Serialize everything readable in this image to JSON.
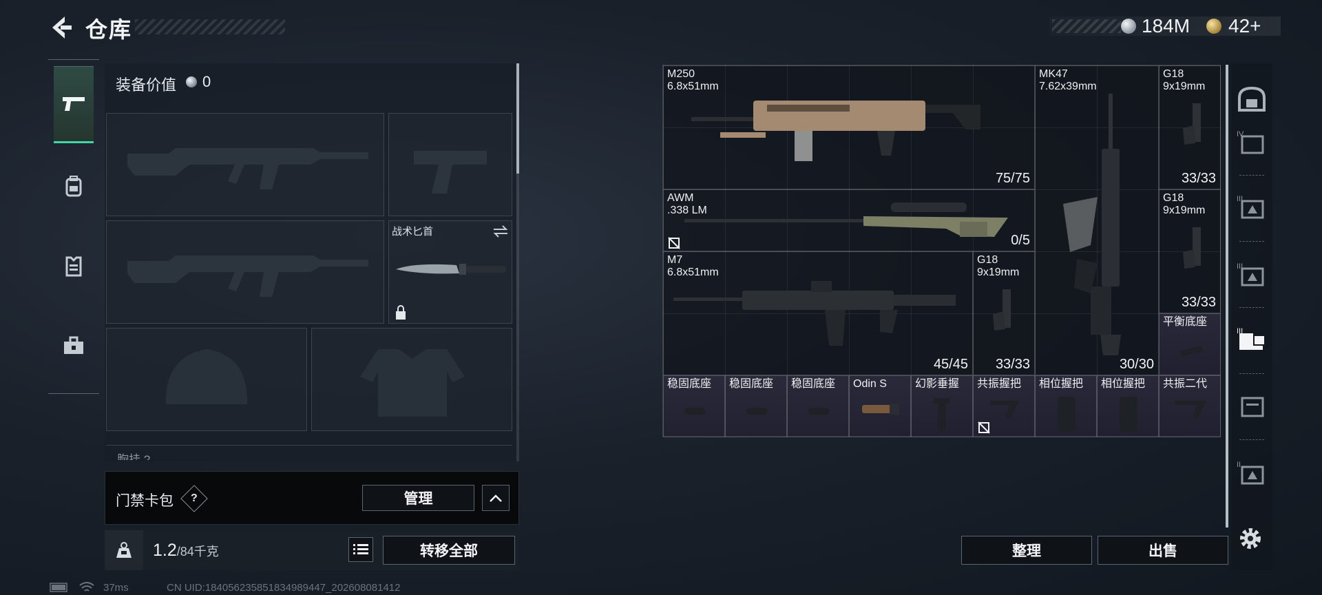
{
  "header": {
    "title": "仓库",
    "currency": [
      {
        "icon": "silver-coin-icon",
        "value": "184M"
      },
      {
        "icon": "gold-coin-icon",
        "value": "42+"
      }
    ]
  },
  "left_nav": {
    "items": [
      "pistol-icon",
      "backpack-icon",
      "vest-icon",
      "toolbox-icon"
    ],
    "active": 0
  },
  "loadout": {
    "equip_value_label": "装备价值",
    "equip_value": "0",
    "knife_slot_label": "战术匕首",
    "chest_label": "胸挂 ?",
    "access_card_label": "门禁卡包",
    "help": "?",
    "manage_button": "管理",
    "weight": "1.2",
    "weight_capacity": "/84千克",
    "transfer_all_button": "转移全部"
  },
  "status": {
    "ping": "37ms",
    "uid": "CN UID:1840562358518349894​47_202608081412"
  },
  "stash_items": [
    {
      "name": "M250",
      "sub": "6.8x51mm",
      "ammo": "75/75",
      "rarity": "normal"
    },
    {
      "name": "MK47",
      "sub": "7.62x39mm",
      "ammo": "30/30",
      "rarity": "normal"
    },
    {
      "name": "G18",
      "sub": "9x19mm",
      "ammo": "33/33",
      "rarity": "normal"
    },
    {
      "name": "AWM",
      "sub": ".338 LM",
      "ammo": "0/5",
      "rarity": "normal"
    },
    {
      "name": "G18",
      "sub": "9x19mm",
      "ammo": "33/33",
      "rarity": "normal"
    },
    {
      "name": "M7",
      "sub": "6.8x51mm",
      "ammo": "45/45",
      "rarity": "normal"
    },
    {
      "name": "G18",
      "sub": "9x19mm",
      "ammo": "33/33",
      "rarity": "normal"
    },
    {
      "name": "平衡底座",
      "rarity": "purple"
    },
    {
      "name": "稳固底座",
      "rarity": "purple"
    },
    {
      "name": "稳固底座",
      "rarity": "purple"
    },
    {
      "name": "稳固底座",
      "rarity": "purple"
    },
    {
      "name": "Odin S",
      "rarity": "purple"
    },
    {
      "name": "幻影垂握",
      "rarity": "purple"
    },
    {
      "name": "共振握把",
      "rarity": "purple"
    },
    {
      "name": "相位握把",
      "rarity": "purple"
    },
    {
      "name": "相位握把",
      "rarity": "purple"
    },
    {
      "name": "共振二代",
      "rarity": "purple"
    }
  ],
  "right_nav": {
    "items": [
      "safe-icon",
      "stash-tab-iv-icon",
      "stash-tab-iii-a-icon",
      "stash-tab-iii-b-icon",
      "stash-tab-iii-active-icon",
      "stash-tab-icon",
      "stash-tab-ii-icon"
    ],
    "active": 4
  },
  "actions": {
    "sort_button": "整理",
    "sell_button": "出售"
  }
}
